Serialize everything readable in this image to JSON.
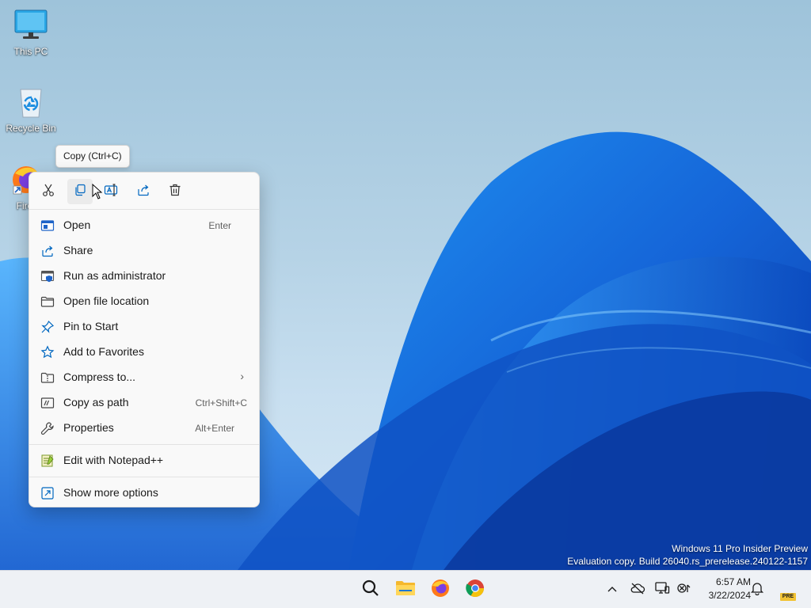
{
  "desktop": {
    "icons": [
      {
        "label": "This PC",
        "icon": "monitor-icon"
      },
      {
        "label": "Recycle Bin",
        "icon": "recycle-bin-icon"
      },
      {
        "label": "Fire",
        "icon": "firefox-shortcut-icon"
      }
    ],
    "watermark": {
      "line1": "Windows 11 Pro Insider Preview",
      "line2": "Evaluation copy. Build 26040.rs_prerelease.240122-1157"
    }
  },
  "tooltip": {
    "text": "Copy (Ctrl+C)"
  },
  "context_menu": {
    "toolbar": [
      {
        "name": "cut",
        "icon": "scissors-icon"
      },
      {
        "name": "copy",
        "icon": "copy-icon"
      },
      {
        "name": "rename",
        "icon": "rename-icon"
      },
      {
        "name": "share",
        "icon": "share-icon"
      },
      {
        "name": "delete",
        "icon": "trash-icon"
      }
    ],
    "items": [
      {
        "label": "Open",
        "shortcut": "Enter",
        "icon": "open-window-icon"
      },
      {
        "label": "Share",
        "shortcut": "",
        "icon": "share-icon"
      },
      {
        "label": "Run as administrator",
        "shortcut": "",
        "icon": "admin-shield-icon"
      },
      {
        "label": "Open file location",
        "shortcut": "",
        "icon": "folder-icon"
      },
      {
        "label": "Pin to Start",
        "shortcut": "",
        "icon": "pin-icon"
      },
      {
        "label": "Add to Favorites",
        "shortcut": "",
        "icon": "star-icon"
      },
      {
        "label": "Compress to...",
        "shortcut": "",
        "icon": "zip-folder-icon",
        "submenu": true
      },
      {
        "label": "Copy as path",
        "shortcut": "Ctrl+Shift+C",
        "icon": "copy-path-icon"
      },
      {
        "label": "Properties",
        "shortcut": "Alt+Enter",
        "icon": "wrench-icon"
      },
      {
        "label": "Edit with Notepad++",
        "shortcut": "",
        "icon": "notepadpp-icon"
      },
      {
        "label": "Show more options",
        "shortcut": "",
        "icon": "expand-icon"
      }
    ],
    "submenu_arrow": "›"
  },
  "taskbar": {
    "apps": [
      {
        "name": "Search",
        "icon": "search-icon"
      },
      {
        "name": "File Explorer",
        "icon": "file-explorer-icon"
      },
      {
        "name": "Firefox",
        "icon": "firefox-icon"
      },
      {
        "name": "Chrome",
        "icon": "chrome-icon"
      }
    ],
    "tray": [
      "chevron-up-icon",
      "cloud-offline-icon",
      "display-icon",
      "network-icon"
    ],
    "time": "6:57 AM",
    "date": "3/22/2024",
    "badge": "PRE"
  },
  "colors": {
    "accent": "#0067c0",
    "menu_bg": "#f9f9f9",
    "taskbar_bg": "#eef1f5"
  }
}
